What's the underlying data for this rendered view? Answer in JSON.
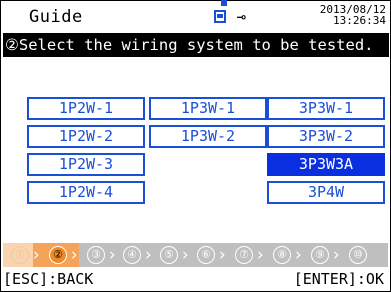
{
  "header": {
    "title": "Guide",
    "date": "2013/08/12",
    "time": "13:26:34",
    "icons": [
      "sd-card-icon",
      "power-plug-icon"
    ]
  },
  "instruction": "②Select the wiring system to be tested.",
  "options": {
    "r1c1": "1P2W-1",
    "r1c2": "1P3W-1",
    "r1c3": "3P3W-1",
    "r2c1": "1P2W-2",
    "r2c2": "1P3W-2",
    "r2c3": "3P3W-2",
    "r3c1": "1P2W-3",
    "r3c3": "3P3W3A",
    "r4c1": "1P2W-4",
    "r4c3": "3P4W",
    "selected": "3P3W3A"
  },
  "steps": [
    "①",
    "②",
    "③",
    "④",
    "⑤",
    "⑥",
    "⑦",
    "⑧",
    "⑨",
    "⑩"
  ],
  "current_step": 2,
  "footer": {
    "back": "[ESC]:BACK",
    "ok": "[ENTER]:OK"
  },
  "colors": {
    "accent": "#1a4fd8",
    "selected": "#0a2fe0",
    "step_current": "#f08a24",
    "stepbar": "#bfbfbf"
  }
}
